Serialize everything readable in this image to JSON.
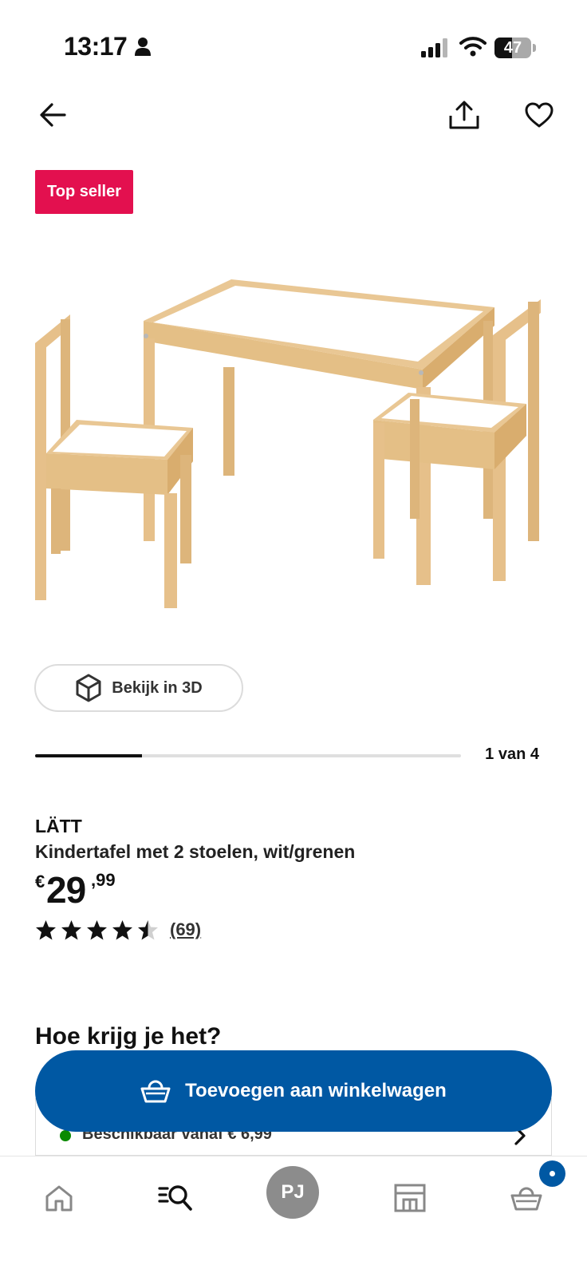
{
  "status_bar": {
    "time": "13:17",
    "battery": "47",
    "battery_level": 0.47,
    "icons": [
      "person-icon",
      "signal-icon",
      "wifi-icon",
      "battery-icon"
    ]
  },
  "header": {
    "icons": [
      "back-arrow-icon",
      "share-icon",
      "heart-icon"
    ]
  },
  "product": {
    "badge": "Top seller",
    "view_3d_label": "Bekijk in 3D",
    "gallery": {
      "current": 1,
      "total": 4,
      "counter_text": "1 van 4",
      "progress": 0.25
    },
    "brand": "LÄTT",
    "description": "Kindertafel met 2 stoelen, wit/grenen",
    "price": {
      "currency": "€",
      "integer": "29",
      "decimals": ",99"
    },
    "rating": {
      "value": 4.5,
      "max": 5,
      "count_text": "(69)"
    }
  },
  "delivery": {
    "section_title": "Hoe krijg je het?",
    "availability_text": "Beschikbaar vanaf € 6,99"
  },
  "cta": {
    "add_to_cart_label": "Toevoegen aan winkelwagen"
  },
  "tabbar": {
    "profile_initials": "PJ",
    "items": [
      "home-icon",
      "search-icon",
      "profile-avatar",
      "store-icon",
      "cart-icon"
    ]
  },
  "colors": {
    "badge": "#e3104f",
    "primary": "#0058a3",
    "available": "#0a8a00"
  }
}
